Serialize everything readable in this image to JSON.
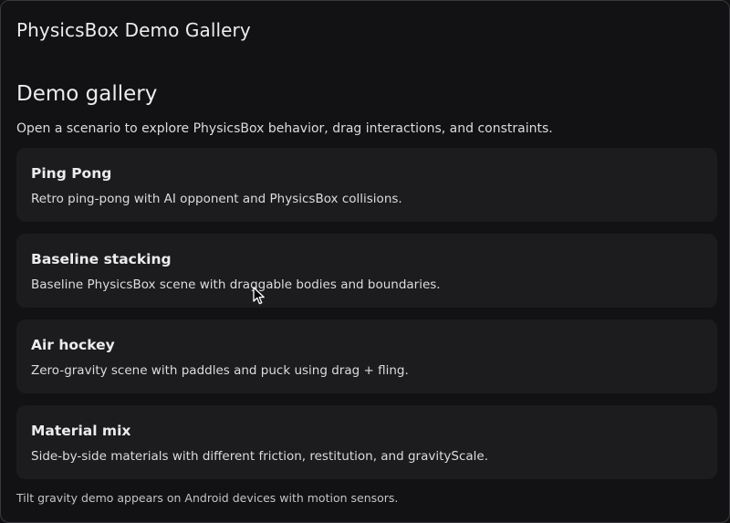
{
  "header": {
    "title": "PhysicsBox Demo Gallery"
  },
  "main": {
    "title": "Demo gallery",
    "subtitle": "Open a scenario to explore PhysicsBox behavior, drag interactions, and constraints.",
    "demos": [
      {
        "title": "Ping Pong",
        "description": "Retro ping-pong with AI opponent and PhysicsBox collisions."
      },
      {
        "title": "Baseline stacking",
        "description": "Baseline PhysicsBox scene with draggable bodies and boundaries."
      },
      {
        "title": "Air hockey",
        "description": "Zero-gravity scene with paddles and puck using drag + fling."
      },
      {
        "title": "Material mix",
        "description": "Side-by-side materials with different friction, restitution, and gravityScale."
      }
    ],
    "footnote": "Tilt gravity demo appears on Android devices with motion sensors."
  },
  "icons": {
    "cursor": "mouse-pointer-icon"
  },
  "colors": {
    "background": "#121214",
    "card": "#1c1c1f",
    "text": "#ececee"
  }
}
